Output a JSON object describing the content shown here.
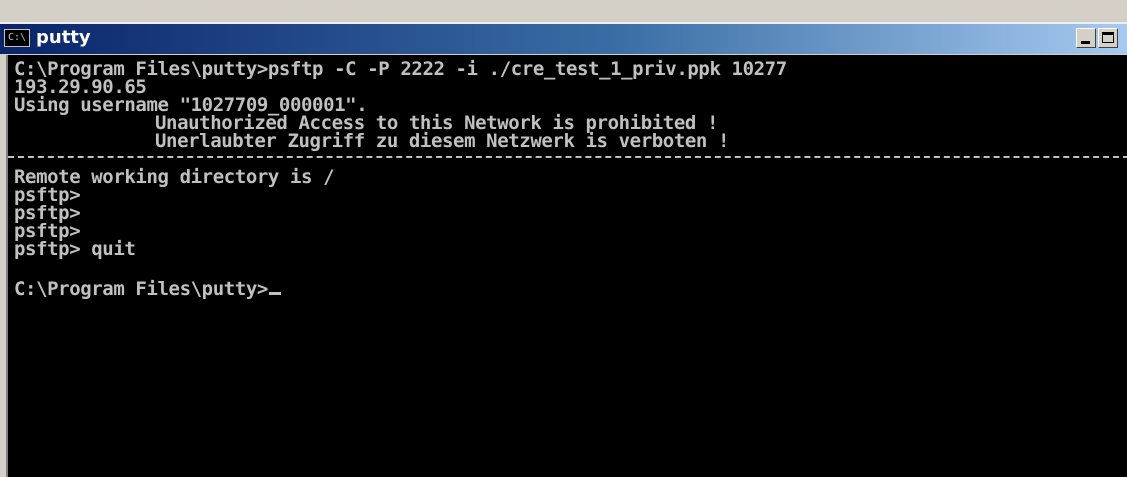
{
  "window": {
    "title": "putty",
    "icon_label": "C:\\",
    "icon": "console-icon",
    "buttons": {
      "minimize": "minimize-icon",
      "maximize": "maximize-icon"
    }
  },
  "console": {
    "lines": [
      "C:\\Program Files\\putty>psftp -C -P 2222 -i ./cre_test_1_priv.ppk 10277",
      "193.29.90.65",
      "Using username \"1027709_000001\".",
      "Unauthorized Access to this Network is prohibited !",
      "Unerlaubter Zugriff zu diesem Netzwerk is verboten !",
      "Remote working directory is /",
      "psftp>",
      "psftp>",
      "psftp>",
      "psftp> quit",
      "C:\\Program Files\\putty>"
    ]
  },
  "colors": {
    "console_background": "#000000",
    "console_text": "#c0c0c0",
    "titlebar_start": "#0a246a",
    "titlebar_end": "#a6caf0"
  }
}
